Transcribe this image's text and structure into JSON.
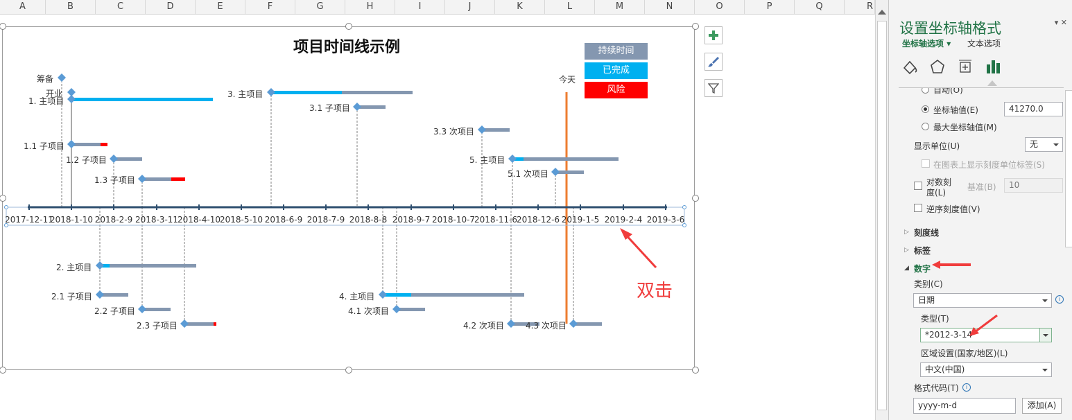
{
  "columns": [
    "A",
    "B",
    "C",
    "D",
    "E",
    "F",
    "G",
    "H",
    "I",
    "J",
    "K",
    "L",
    "M",
    "N",
    "O",
    "P",
    "Q",
    "R"
  ],
  "chart": {
    "title": "项目时间线示例",
    "legend": [
      {
        "label": "持续时间",
        "color": "#8497b0"
      },
      {
        "label": "已完成",
        "color": "#00b0f0"
      },
      {
        "label": "风险",
        "color": "#ff0000"
      }
    ],
    "today_label": "今天",
    "axis_labels": [
      "2017-12-11",
      "2018-1-10",
      "2018-2-9",
      "2018-3-11",
      "2018-4-10",
      "2018-5-10",
      "2018-6-9",
      "2018-7-9",
      "2018-8-8",
      "2018-9-7",
      "2018-10-7",
      "2018-11-6",
      "2018-12-6",
      "2019-1-5",
      "2019-2-4",
      "2019-3-6"
    ],
    "tasks": [
      {
        "label": "筹备"
      },
      {
        "label": "开业"
      },
      {
        "label": "1. 主项目"
      },
      {
        "label": "1.1 子项目"
      },
      {
        "label": "1.2 子项目"
      },
      {
        "label": "1.3 子项目"
      },
      {
        "label": "3. 主项目"
      },
      {
        "label": "3.1 子项目"
      },
      {
        "label": "3.3 次项目"
      },
      {
        "label": "5. 主项目"
      },
      {
        "label": "5.1 次项目"
      },
      {
        "label": "2. 主项目"
      },
      {
        "label": "2.1 子项目"
      },
      {
        "label": "2.2 子项目"
      },
      {
        "label": "2.3 子项目"
      },
      {
        "label": "4. 主项目"
      },
      {
        "label": "4.1 次项目"
      },
      {
        "label": "4.2 次项目"
      },
      {
        "label": "4.3 次项目"
      }
    ]
  },
  "annotation": {
    "text": "双击"
  },
  "panel": {
    "title": "设置坐标轴格式",
    "tab_axis_options": "坐标轴选项",
    "tab_text_options": "文本选项",
    "radio_auto": "自动(O)",
    "radio_axis_value": "坐标轴值(E)",
    "axis_value": "41270.0",
    "radio_max": "最大坐标轴值(M)",
    "display_unit_label": "显示单位(U)",
    "display_unit_value": "无",
    "show_unit_label": "在图表上显示刻度单位标签(S)",
    "log_scale_label_1": "对数刻",
    "log_scale_label_2": "度(L)",
    "base_label": "基准(B)",
    "base_value": "10",
    "reverse_label": "逆序刻度值(V)",
    "section_tickmarks": "刻度线",
    "section_labels": "标签",
    "section_number": "数字",
    "category_label": "类别(C)",
    "category_value": "日期",
    "type_label": "类型(T)",
    "type_value": "*2012-3-14",
    "locale_label": "区域设置(国家/地区)(L)",
    "locale_value": "中文(中国)",
    "format_code_label": "格式代码(T)",
    "format_code_value": "yyyy-m-d",
    "add_button": "添加(A)"
  }
}
